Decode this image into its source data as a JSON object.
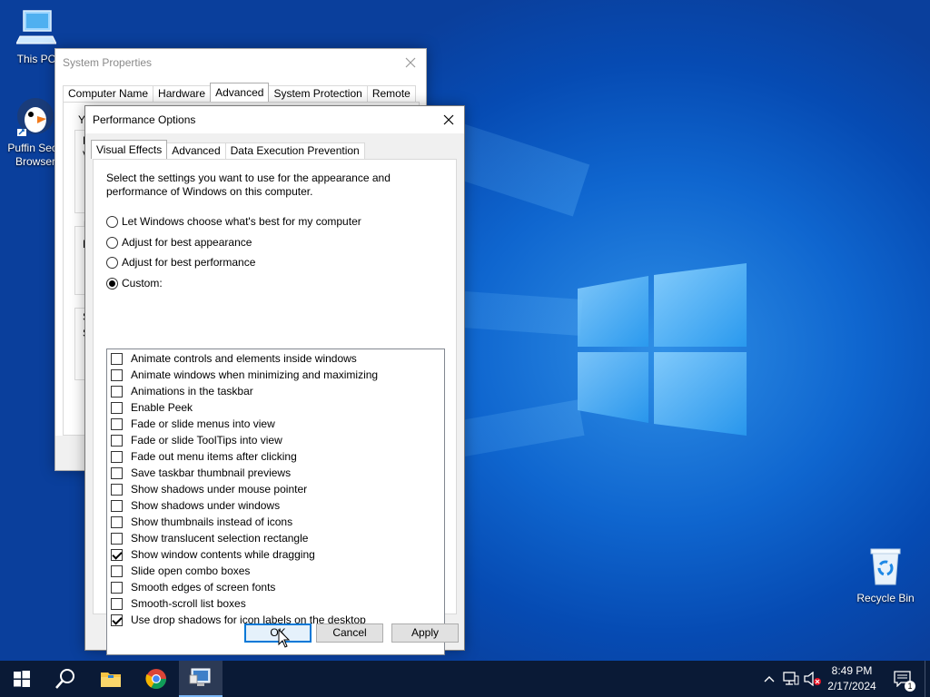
{
  "desktop": {
    "icons": [
      {
        "label": "This PC"
      },
      {
        "label": "Puffin Secu Browser"
      },
      {
        "label": "Recycle Bin"
      }
    ]
  },
  "system_properties": {
    "title": "System Properties",
    "tabs": [
      "Computer Name",
      "Hardware",
      "Advanced",
      "System Protection",
      "Remote"
    ],
    "active_tab": "Advanced",
    "partial_letters": [
      "Y",
      "F",
      "V",
      "U",
      "D",
      "S",
      "S"
    ]
  },
  "performance_options": {
    "title": "Performance Options",
    "tabs": [
      "Visual Effects",
      "Advanced",
      "Data Execution Prevention"
    ],
    "active_tab": "Visual Effects",
    "description": "Select the settings you want to use for the appearance and performance of Windows on this computer.",
    "radio_options": [
      {
        "label": "Let Windows choose what's best for my computer",
        "selected": false
      },
      {
        "label": "Adjust for best appearance",
        "selected": false
      },
      {
        "label": "Adjust for best performance",
        "selected": false
      },
      {
        "label": "Custom:",
        "selected": true
      }
    ],
    "effects": [
      {
        "label": "Animate controls and elements inside windows",
        "checked": false
      },
      {
        "label": "Animate windows when minimizing and maximizing",
        "checked": false
      },
      {
        "label": "Animations in the taskbar",
        "checked": false
      },
      {
        "label": "Enable Peek",
        "checked": false
      },
      {
        "label": "Fade or slide menus into view",
        "checked": false
      },
      {
        "label": "Fade or slide ToolTips into view",
        "checked": false
      },
      {
        "label": "Fade out menu items after clicking",
        "checked": false
      },
      {
        "label": "Save taskbar thumbnail previews",
        "checked": false
      },
      {
        "label": "Show shadows under mouse pointer",
        "checked": false
      },
      {
        "label": "Show shadows under windows",
        "checked": false
      },
      {
        "label": "Show thumbnails instead of icons",
        "checked": false
      },
      {
        "label": "Show translucent selection rectangle",
        "checked": false
      },
      {
        "label": "Show window contents while dragging",
        "checked": true
      },
      {
        "label": "Slide open combo boxes",
        "checked": false
      },
      {
        "label": "Smooth edges of screen fonts",
        "checked": false
      },
      {
        "label": "Smooth-scroll list boxes",
        "checked": false
      },
      {
        "label": "Use drop shadows for icon labels on the desktop",
        "checked": true
      }
    ],
    "buttons": {
      "ok": "OK",
      "cancel": "Cancel",
      "apply": "Apply"
    }
  },
  "taskbar": {
    "items": [
      "start-icon",
      "search-icon",
      "file-explorer-icon",
      "chrome-icon",
      "system-properties-icon"
    ],
    "clock": {
      "time": "8:49 PM",
      "date": "2/17/2024"
    },
    "notification_count": "1"
  },
  "colors": {
    "accent": "#0078d7",
    "taskbar": "#0a1a36",
    "desktop": "#0b5ec9"
  }
}
